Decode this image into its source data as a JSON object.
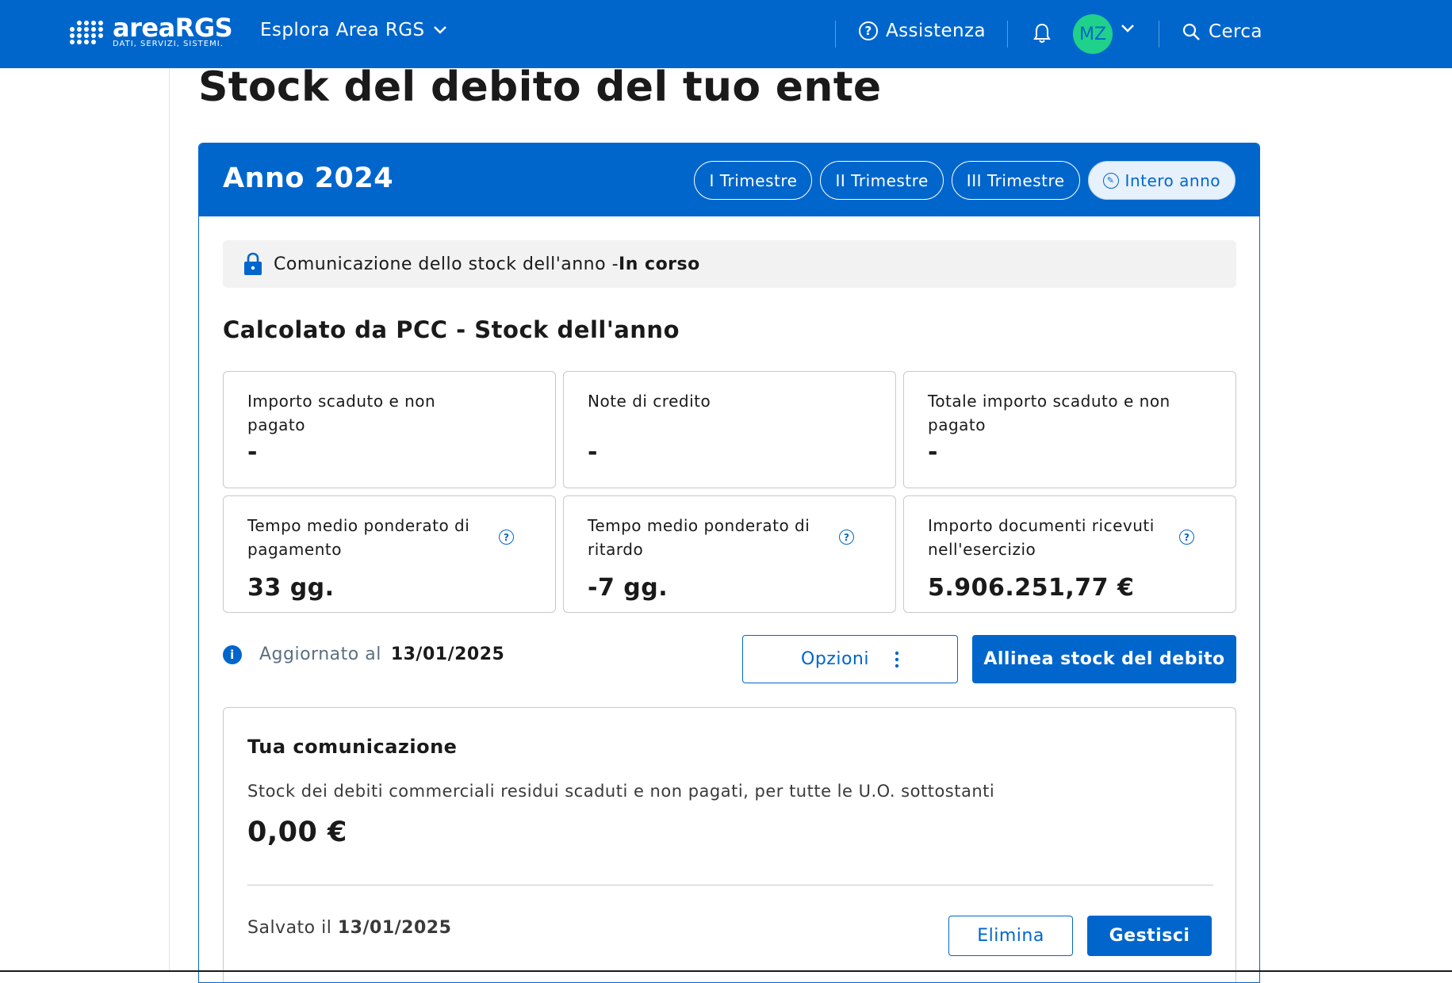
{
  "topbar": {
    "logo_name": "areaRGS",
    "logo_tagline": "DATI, SERVIZI, SISTEMI.",
    "explore_label": "Esplora Area RGS",
    "help_label": "Assistenza",
    "avatar_initials": "MZ",
    "search_label": "Cerca"
  },
  "page": {
    "title": "Stock del debito del tuo ente"
  },
  "year_card": {
    "title": "Anno 2024",
    "tabs": [
      {
        "label": "I Trimestre",
        "active": false
      },
      {
        "label": "II Trimestre",
        "active": false
      },
      {
        "label": "III Trimestre",
        "active": false
      },
      {
        "label": "Intero anno",
        "active": true
      }
    ],
    "status_text": "Comunicazione dello stock dell'anno - ",
    "status_value": "In corso",
    "section_title": "Calcolato da PCC - Stock dell'anno",
    "kpis": [
      {
        "label": "Importo scaduto e non pagato",
        "value": "-"
      },
      {
        "label": "Note di credito",
        "value": "-"
      },
      {
        "label": "Totale importo scaduto e non pagato",
        "value": "-"
      },
      {
        "label": "Tempo medio ponderato di pagamento",
        "value": "33 gg."
      },
      {
        "label": "Tempo medio ponderato di ritardo",
        "value": "-7 gg."
      },
      {
        "label": "Importo documenti ricevuti nell'esercizio",
        "value": "5.906.251,77 €"
      }
    ],
    "updated_label": "Aggiornato al",
    "updated_date": "13/01/2025",
    "options_label": "Opzioni",
    "align_label": "Allinea stock del debito"
  },
  "communication": {
    "title": "Tua comunicazione",
    "description": "Stock dei debiti commerciali residui scaduti e non pagati, per tutte le U.O. sottostanti",
    "amount": "0,00 €",
    "saved_label": "Salvato il",
    "saved_date": "13/01/2025",
    "delete_label": "Elimina",
    "manage_label": "Gestisci"
  },
  "colors": {
    "primary": "#0066cc",
    "avatar_bg": "#1fd18a"
  }
}
